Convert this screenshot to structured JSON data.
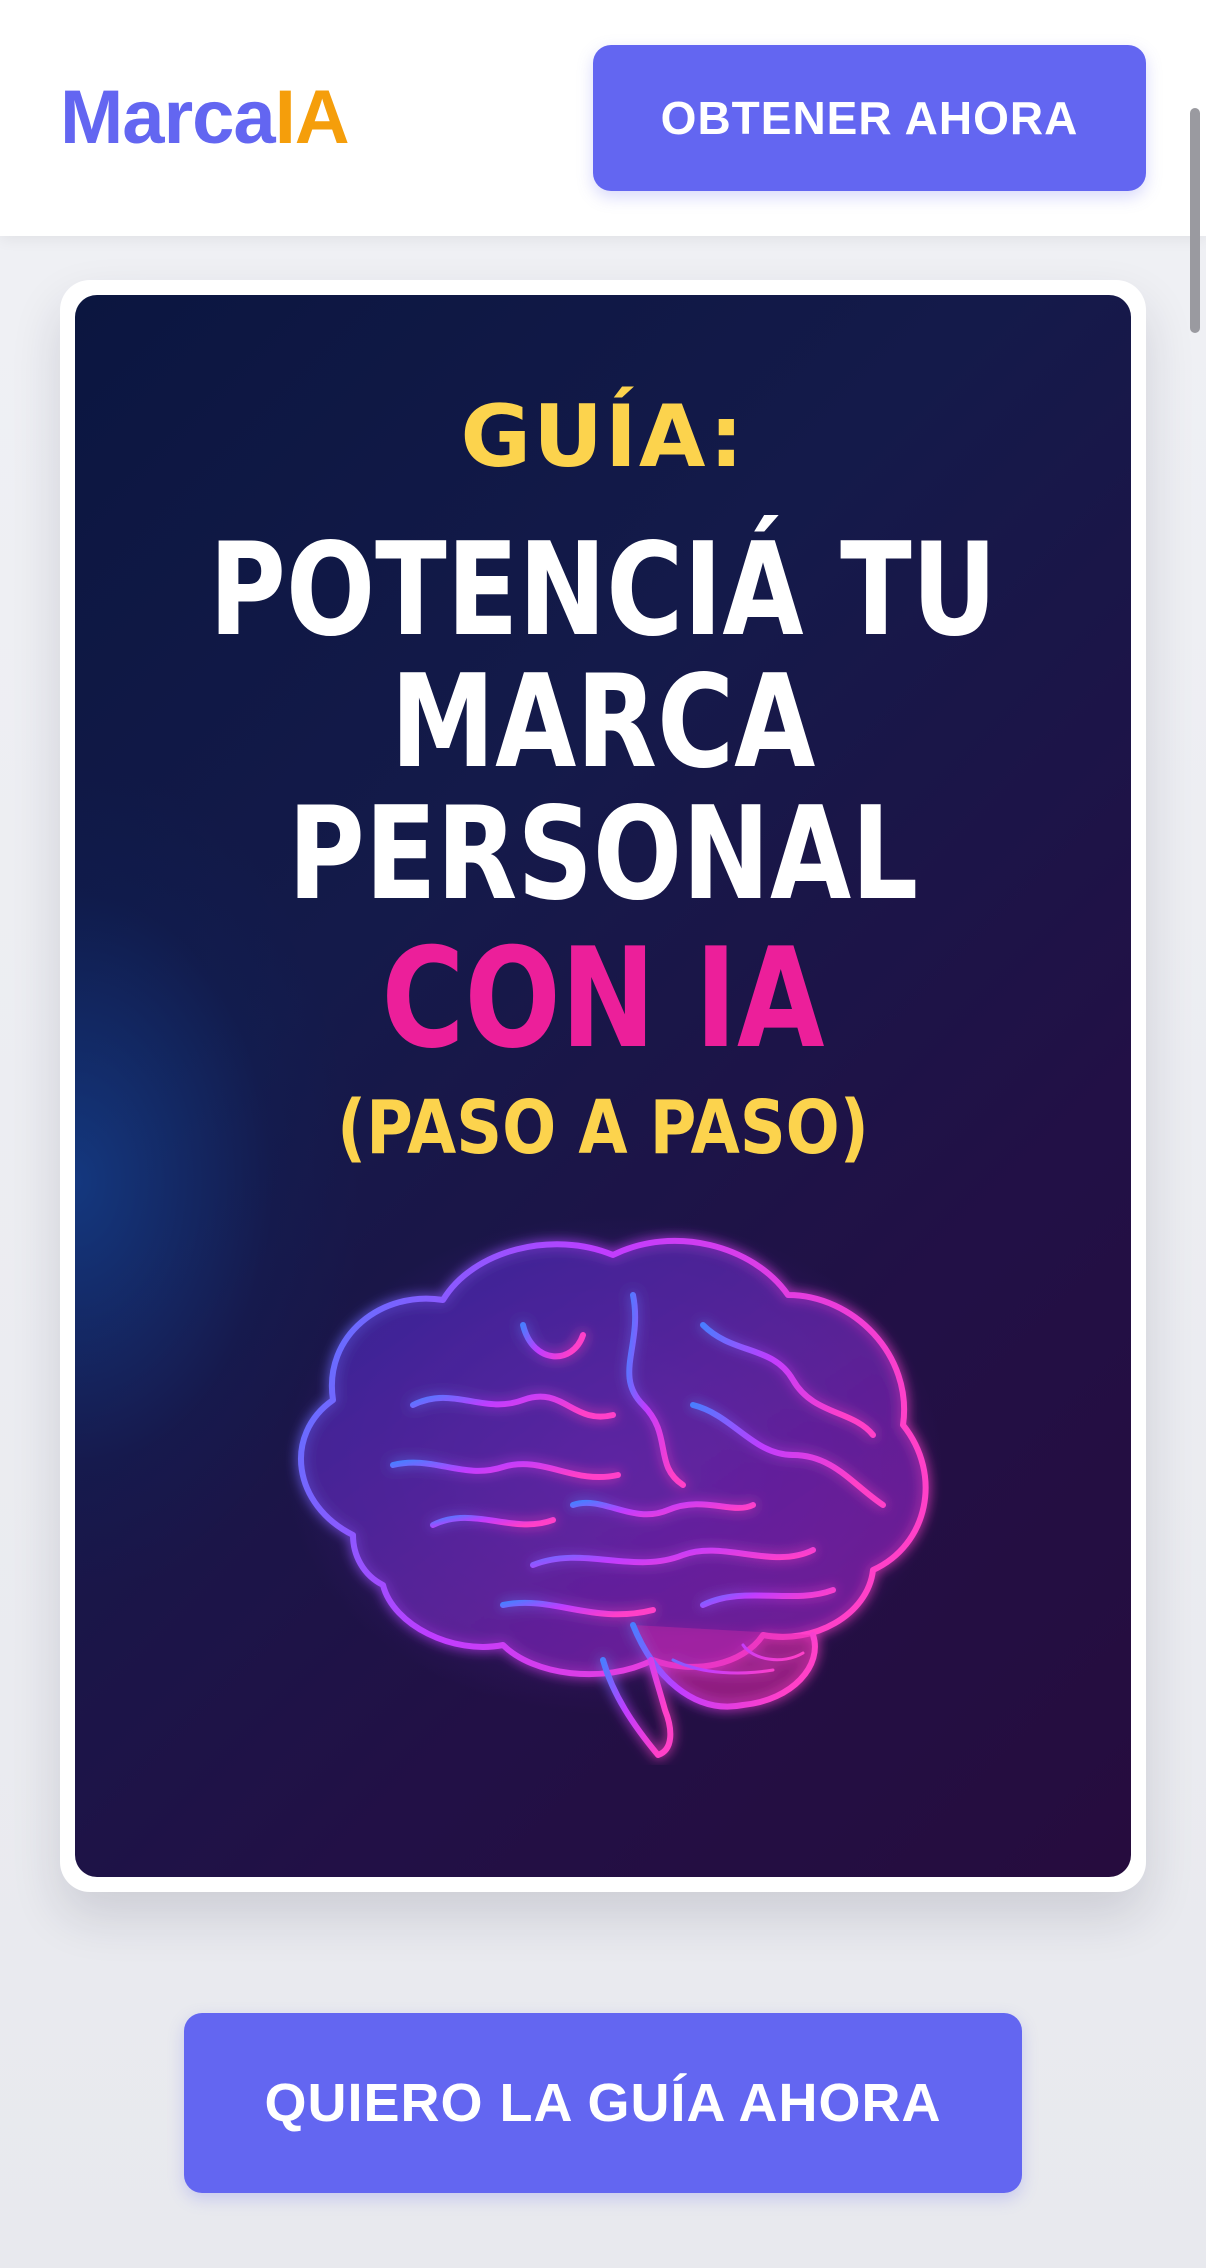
{
  "header": {
    "logo_part1": "Marca",
    "logo_part2": "IA",
    "cta_label": "OBTENER AHORA"
  },
  "cover": {
    "kicker": "GUÍA:",
    "title_lines": [
      "POTENCIÁ TU",
      "MARCA",
      "PERSONAL"
    ],
    "highlight": "CON IA",
    "subtitle": "(PASO A PASO)",
    "image": "glowing-brain-icon"
  },
  "main": {
    "cta_label": "QUIERO LA GUÍA AHORA"
  },
  "colors": {
    "accent": "#6366f1",
    "logo_secondary": "#f59e0b",
    "cover_yellow": "#fcd34d",
    "cover_pink": "#ec1f9a"
  }
}
